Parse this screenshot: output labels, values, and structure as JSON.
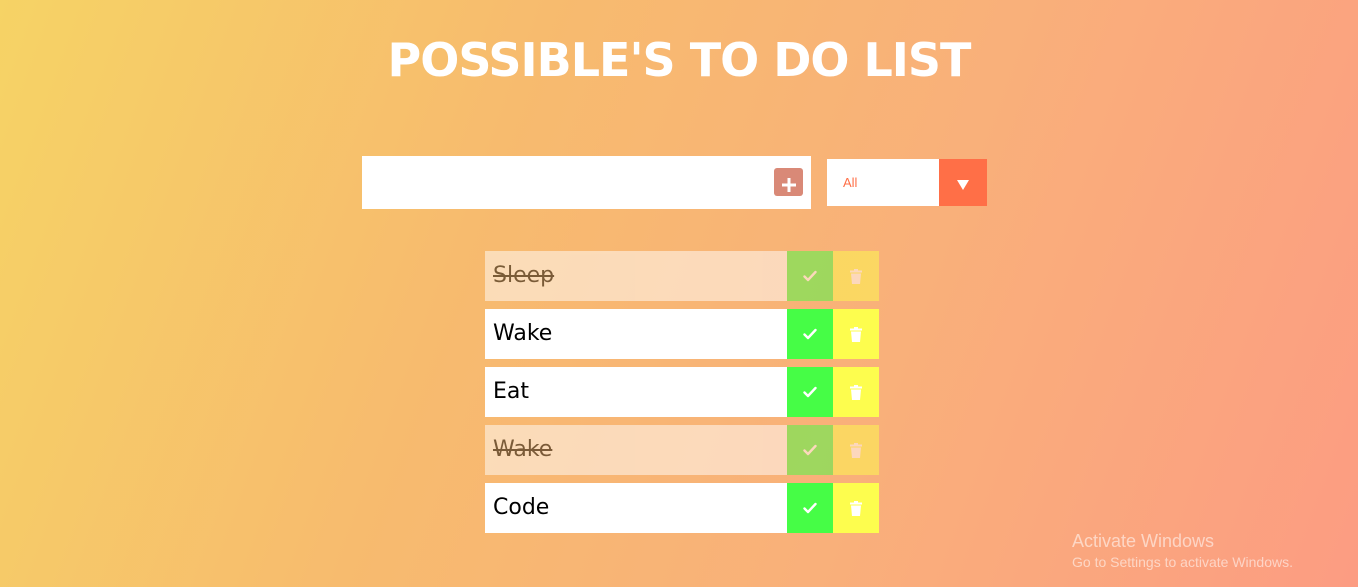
{
  "header": {
    "title": "POSSIBLE'S TO DO LIST"
  },
  "form": {
    "input_value": "",
    "add_icon": "plus-square-icon",
    "filter": {
      "selected": "All",
      "arrow_icon": "caret-down-icon"
    }
  },
  "todos": [
    {
      "text": "Sleep",
      "completed": true
    },
    {
      "text": "Wake",
      "completed": false
    },
    {
      "text": "Eat",
      "completed": false
    },
    {
      "text": "Wake",
      "completed": true
    },
    {
      "text": "Code",
      "completed": false
    }
  ],
  "icons": {
    "complete": "check-icon",
    "delete": "trash-icon"
  },
  "colors": {
    "accent": "#ff6f47",
    "add_button": "#d98977",
    "complete_button": "#46fd46",
    "trash_button": "#fdfd4e"
  },
  "watermark": {
    "title": "Activate Windows",
    "subtitle": "Go to Settings to activate Windows."
  }
}
